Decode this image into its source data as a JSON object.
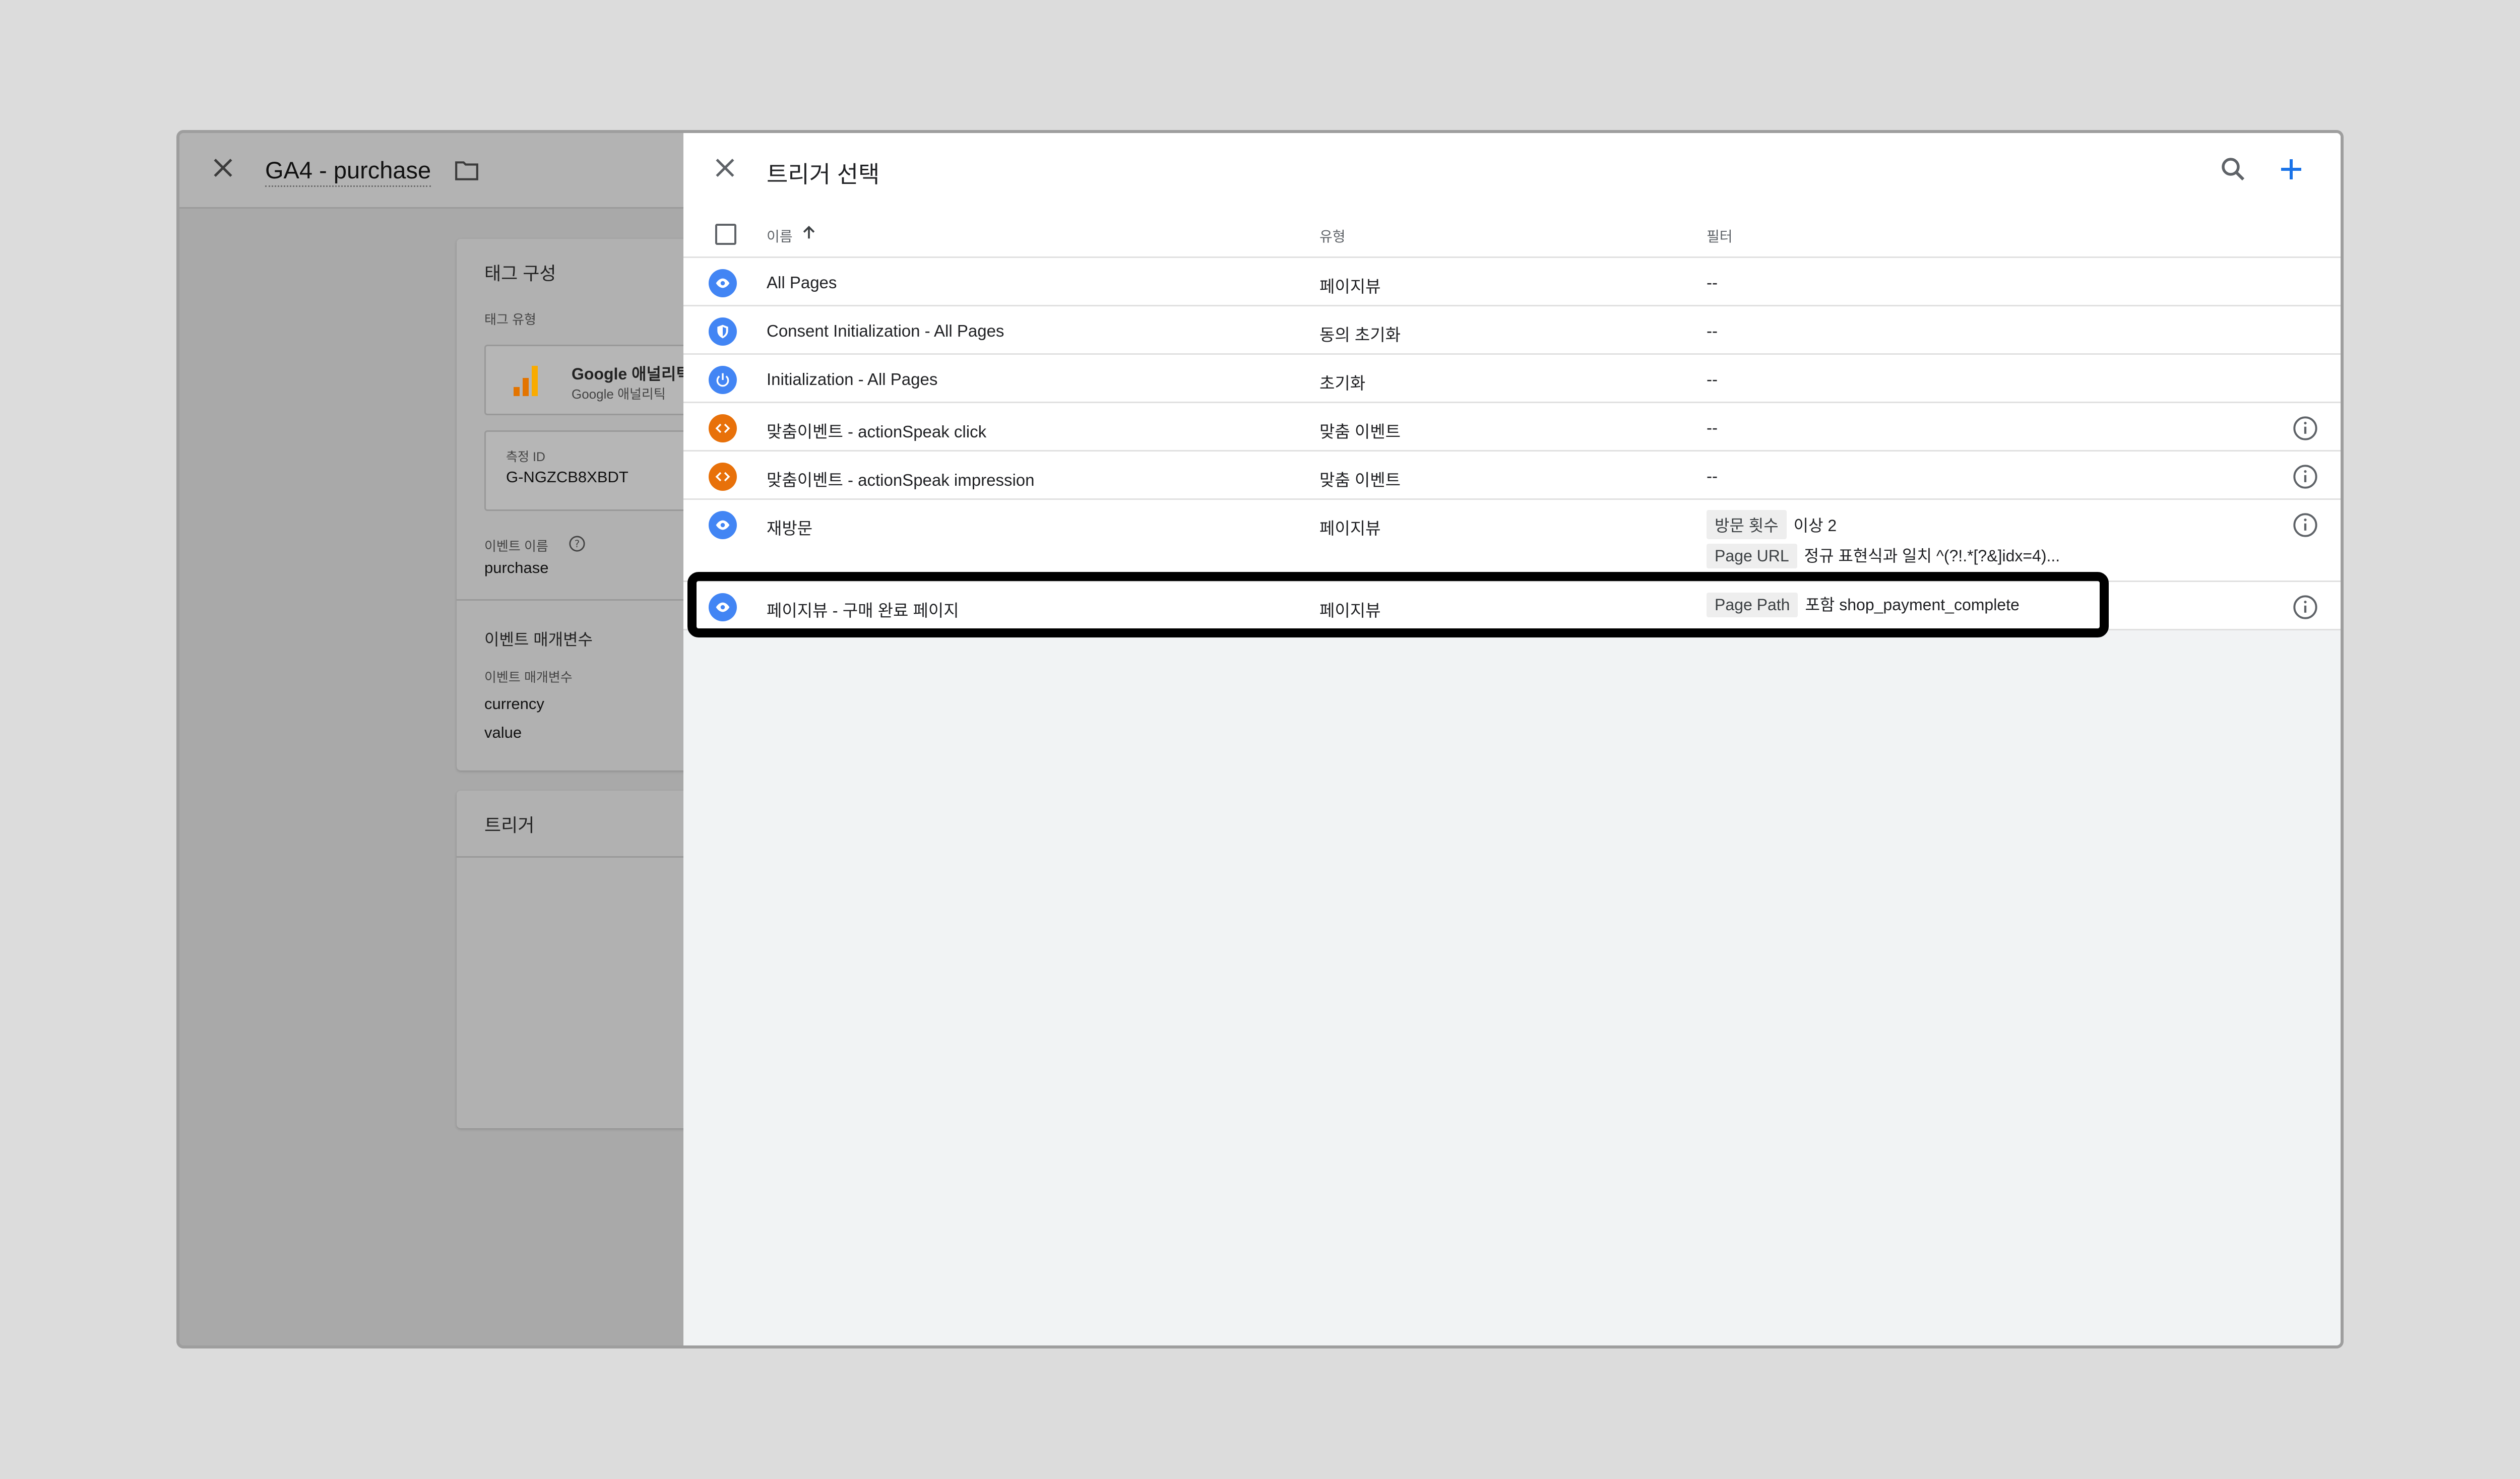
{
  "background_editor": {
    "title": "GA4 - purchase",
    "tag_config_title": "태그 구성",
    "tag_type_label": "태그 유형",
    "tag_type_name": "Google 애널리틱",
    "tag_type_sub": "Google 애널리틱",
    "measurement_id_label": "측정 ID",
    "measurement_id_value": "G-NGZCB8XBDT",
    "event_name_label": "이벤트 이름",
    "event_name_value": "purchase",
    "event_params_title": "이벤트 매개변수",
    "event_params_label": "이벤트 매개변수",
    "event_params": [
      "currency",
      "value"
    ],
    "trigger_title": "트리거"
  },
  "panel": {
    "title": "트리거 선택",
    "columns": {
      "name": "이름",
      "type": "유형",
      "filter": "필터"
    },
    "rows": [
      {
        "name": "All Pages",
        "type": "페이지뷰",
        "filter": "--",
        "icon": "eye-icon",
        "color": "#4285f4"
      },
      {
        "name": "Consent Initialization - All Pages",
        "type": "동의 초기화",
        "filter": "--",
        "icon": "shield-icon",
        "color": "#4285f4"
      },
      {
        "name": "Initialization - All Pages",
        "type": "초기화",
        "filter": "--",
        "icon": "power-icon",
        "color": "#4285f4"
      },
      {
        "name": "맞춤이벤트 - actionSpeak click",
        "type": "맞춤 이벤트",
        "filter": "--",
        "icon": "code-icon",
        "color": "#e8710a"
      },
      {
        "name": "맞춤이벤트 - actionSpeak impression",
        "type": "맞춤 이벤트",
        "filter": "--",
        "icon": "code-icon",
        "color": "#e8710a"
      },
      {
        "name": "재방문",
        "type": "페이지뷰",
        "icon": "eye-icon",
        "color": "#4285f4",
        "filter1_chip": "방문 횟수",
        "filter1_text": "이상 2",
        "filter2_chip": "Page URL",
        "filter2_text": "정규 표현식과 일치 ^(?!.*[?&]idx=4)..."
      },
      {
        "name": "페이지뷰 - 구매 완료 페이지",
        "type": "페이지뷰",
        "icon": "eye-icon",
        "color": "#4285f4",
        "filter1_chip": "Page Path",
        "filter1_text": "포함 shop_payment_complete"
      }
    ]
  },
  "colors": {
    "accent": "#1a73e8",
    "highlight_border": "#000000"
  }
}
